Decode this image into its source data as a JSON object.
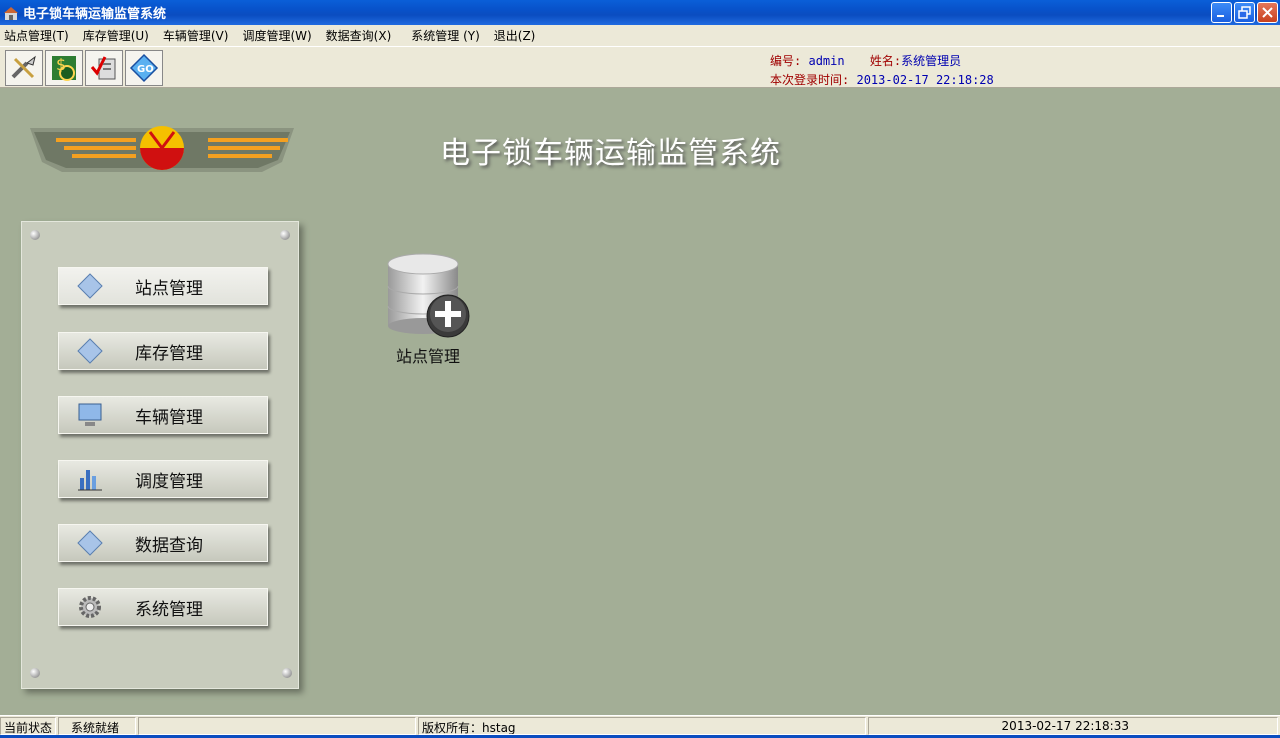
{
  "window": {
    "title": "电子锁车辆运输监管系统"
  },
  "menu": [
    "站点管理(T)",
    "库存管理(U)",
    "车辆管理(V)",
    "调度管理(W)",
    "数据查询(X)",
    "系统管理 (Y)",
    "退出(Z)"
  ],
  "toolbar": {
    "buttons": [
      "tools-icon",
      "money-icon",
      "checklist-icon",
      "go-icon"
    ]
  },
  "user_info": {
    "id_label": "编号:",
    "id_value": "admin",
    "name_label": "姓名:",
    "name_value": "系统管理员",
    "login_label": "本次登录时间:",
    "login_value": "2013-02-17 22:18:28"
  },
  "main": {
    "title": "电子锁车辆运输监管系统"
  },
  "nav": [
    {
      "label": "站点管理",
      "icon": "diamond-icon"
    },
    {
      "label": "库存管理",
      "icon": "diamond-icon"
    },
    {
      "label": "车辆管理",
      "icon": "monitor-icon"
    },
    {
      "label": "调度管理",
      "icon": "chart-icon"
    },
    {
      "label": "数据查询",
      "icon": "diamond-icon"
    },
    {
      "label": "系统管理",
      "icon": "gear-icon"
    }
  ],
  "desktop": {
    "label": "站点管理",
    "icon": "database-add-icon"
  },
  "status": {
    "state_label": "当前状态",
    "state_value": "系统就绪",
    "copyright": "版权所有：hstag",
    "time": "2013-02-17 22:18:33"
  },
  "colors": {
    "titlebar": "#0a5fd8",
    "desktop": "#a3ae96",
    "label_red": "#a00000",
    "value_blue": "#0000b0"
  }
}
